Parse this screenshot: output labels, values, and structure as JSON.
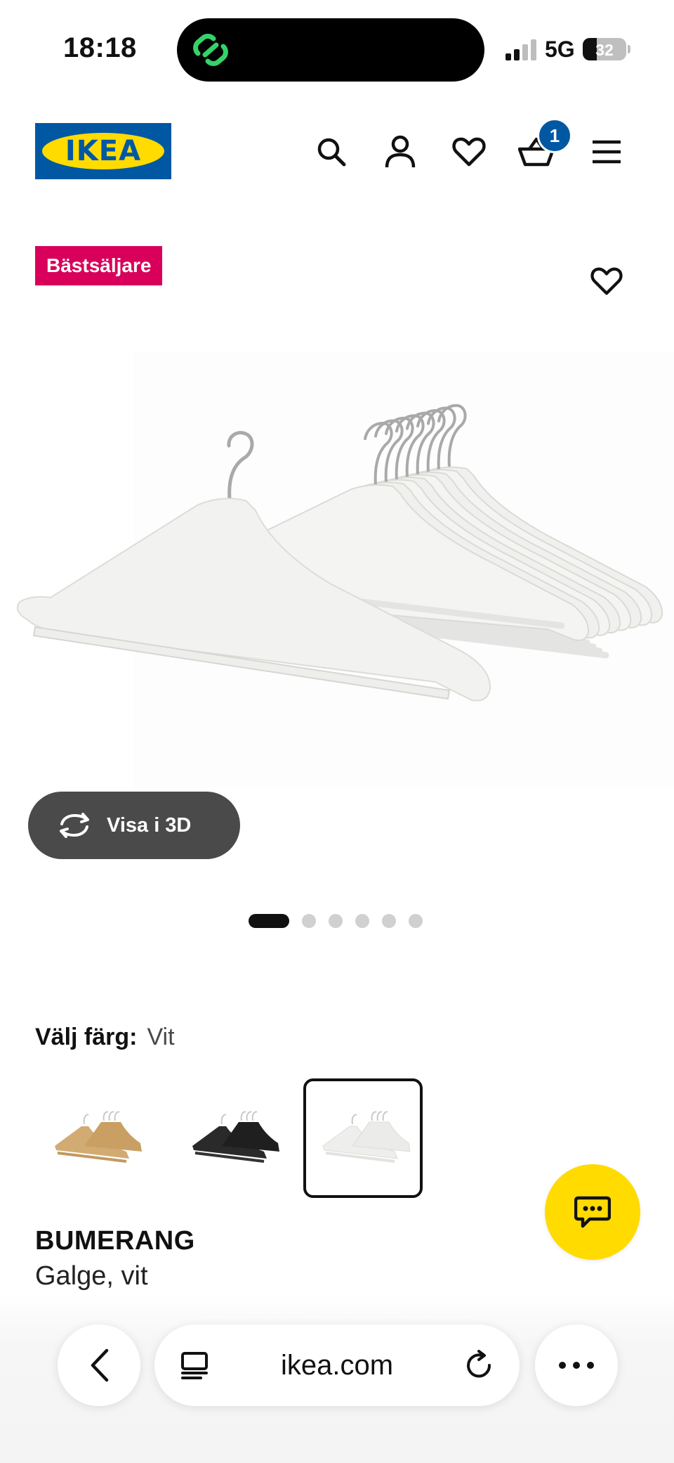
{
  "status_bar": {
    "time": "18:18",
    "network": "5G",
    "battery": "32",
    "battery_level": 0.32
  },
  "header": {
    "logo_text": "IKEA",
    "cart_count": "1"
  },
  "product": {
    "badge": "Bästsäljare",
    "view_3d_label": "Visa i 3D",
    "image_count": 6,
    "active_image": 0,
    "color_label": "Välj färg:",
    "color_value": "Vit",
    "colors": [
      "natural wood",
      "black",
      "white"
    ],
    "selected_color_index": 2,
    "name": "BUMERANG",
    "description": "Galge, vit"
  },
  "browser": {
    "url": "ikea.com"
  },
  "colors": {
    "ikea_blue": "#0058a3",
    "ikea_yellow": "#ffdb00",
    "badge_pink": "#d9005b",
    "button_grey": "#4a4a4a"
  },
  "icons": [
    "search-icon",
    "account-icon",
    "heart-icon",
    "cart-icon",
    "menu-icon",
    "rotate-3d-icon",
    "chat-icon",
    "back-icon",
    "tabs-icon",
    "reload-icon",
    "more-icon"
  ]
}
